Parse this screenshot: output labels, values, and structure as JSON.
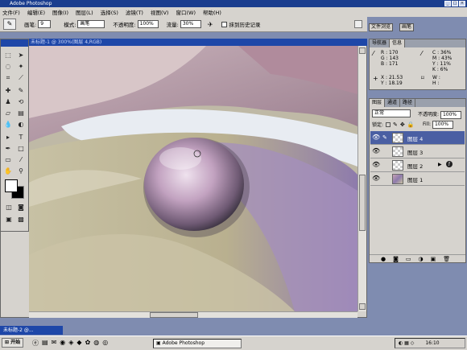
{
  "window": {
    "title": "Adobe Photoshop"
  },
  "menu": [
    "文件(F)",
    "编辑(E)",
    "图像(I)",
    "图层(L)",
    "选择(S)",
    "滤镜(T)",
    "视图(V)",
    "窗口(W)",
    "帮助(H)"
  ],
  "options": {
    "brush_label": "画笔:",
    "brush_size": "9",
    "mode_label": "模式:",
    "mode_value": "画笔",
    "opacity_label": "不透明度:",
    "opacity_value": "100%",
    "pressure_label": "流量:",
    "pressure_value": "30%",
    "history_label": "抹到历史记录"
  },
  "well": {
    "tab1": "文件浏览",
    "tab2": "画笔"
  },
  "document": {
    "title": "未标题-1 @ 300%(图层 4,RGB)"
  },
  "navigator": {
    "tab_nav": "导航器",
    "tab_info": "信息",
    "r_label": "R :",
    "r": "170",
    "g_label": "G :",
    "g": "143",
    "b_label": "B :",
    "b": "171",
    "c_label": "C :",
    "c": "36%",
    "m_label": "M :",
    "m": "43%",
    "y_label": "Y :",
    "y": "11%",
    "k_label": "K :",
    "k": "6%",
    "x_label": "X :",
    "x": "21.53",
    "y2_label": "Y :",
    "y2": "18.19",
    "w_label": "W :",
    "h_label": "H :"
  },
  "layers": {
    "tab_layers": "图层",
    "tab_channels": "通道",
    "tab_paths": "路径",
    "mode": "正常",
    "opacity_label": "不透明度:",
    "opacity": "100%",
    "lock_label": "锁定:",
    "fill_label": "Fill:",
    "fill": "100%",
    "items": [
      {
        "name": "图层 4"
      },
      {
        "name": "图层 3"
      },
      {
        "name": "图层 2"
      },
      {
        "name": "图层 1"
      }
    ]
  },
  "taskbar": {
    "start": "开始",
    "minimized_doc": "未标题-2 @...",
    "app_button": "Adobe Photoshop",
    "clock": "16:10"
  }
}
